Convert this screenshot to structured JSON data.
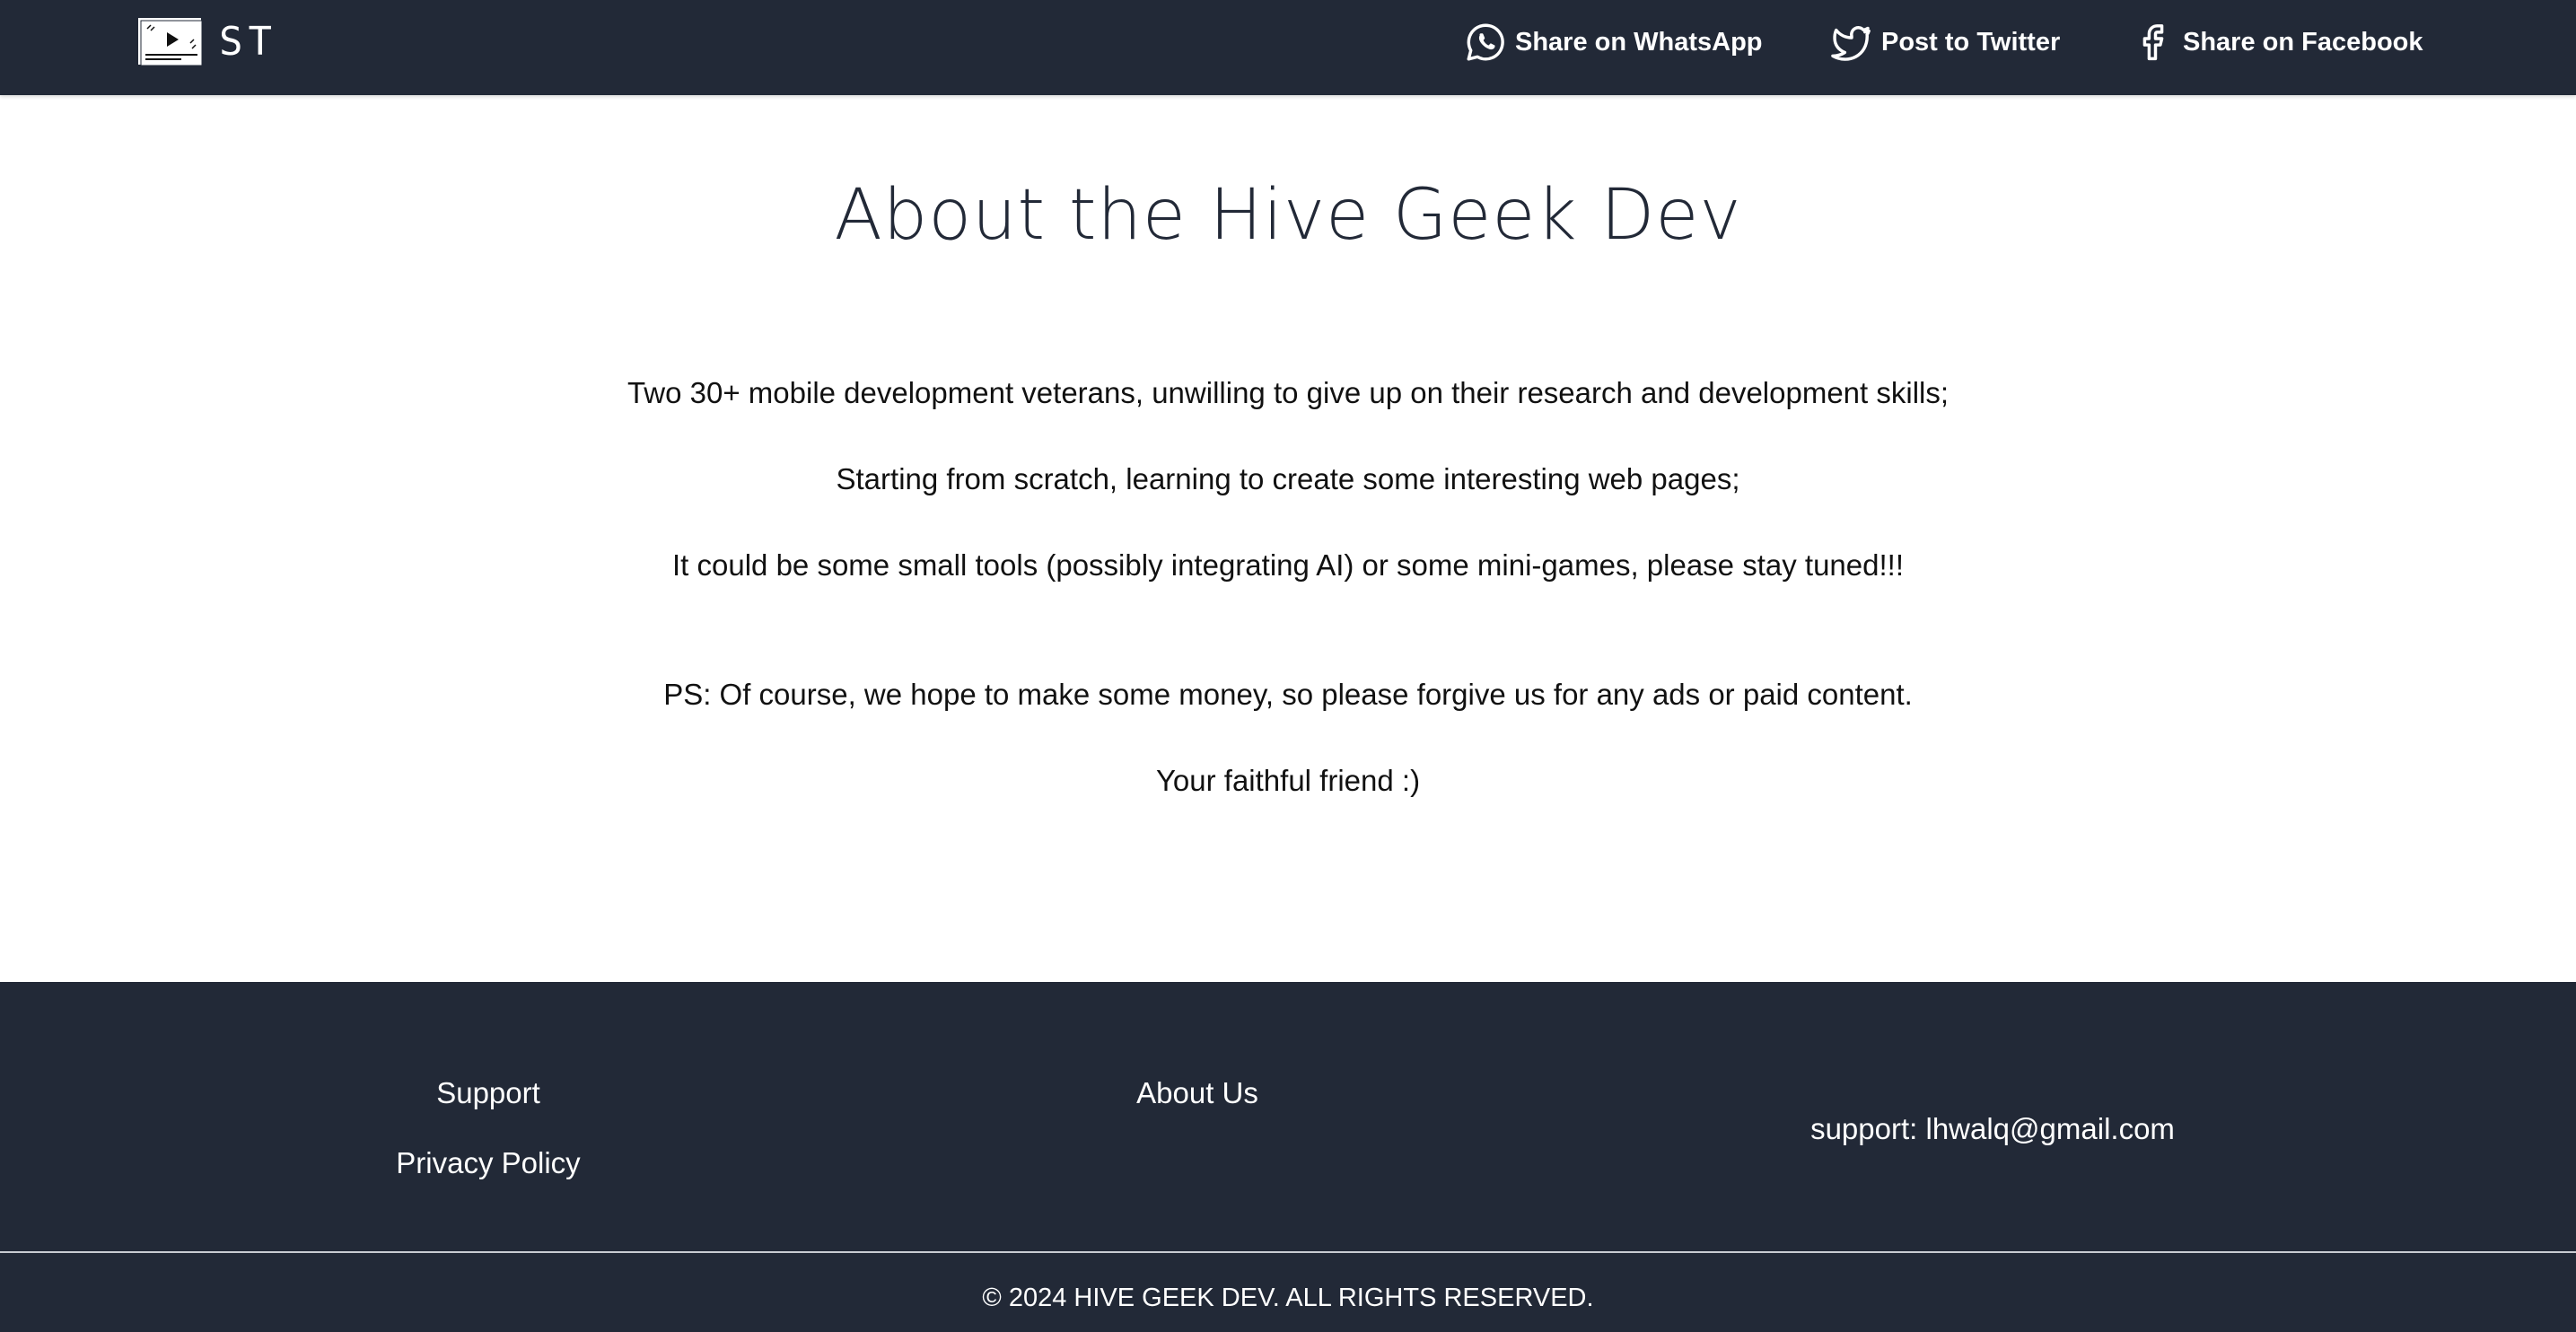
{
  "header": {
    "logo_text": "ST",
    "share_whatsapp": "Share on WhatsApp",
    "share_twitter": "Post to Twitter",
    "share_facebook": "Share on Facebook"
  },
  "main": {
    "title": "About the Hive Geek Dev",
    "paragraphs": [
      "Two 30+ mobile development veterans, unwilling to give up on their research and development skills;",
      "Starting from scratch, learning to create some interesting web pages;",
      "It could be some small tools (possibly integrating AI) or some mini-games, please stay tuned!!!",
      "PS: Of course, we hope to make some money, so please forgive us for any ads or paid content.",
      "Your faithful friend :)"
    ]
  },
  "footer": {
    "support": "Support",
    "privacy_policy": "Privacy Policy",
    "about_us": "About Us",
    "email": "support: lhwalq@gmail.com",
    "copyright": "© 2024 HIVE GEEK DEV. ALL RIGHTS RESERVED."
  },
  "colors": {
    "nav_bg": "#222937",
    "footer_bg": "#222937",
    "text_on_dark": "#ffffff"
  },
  "icons": {
    "logo": "video-player-logo",
    "whatsapp": "whatsapp-icon",
    "twitter": "twitter-bird-icon",
    "facebook": "facebook-icon"
  }
}
